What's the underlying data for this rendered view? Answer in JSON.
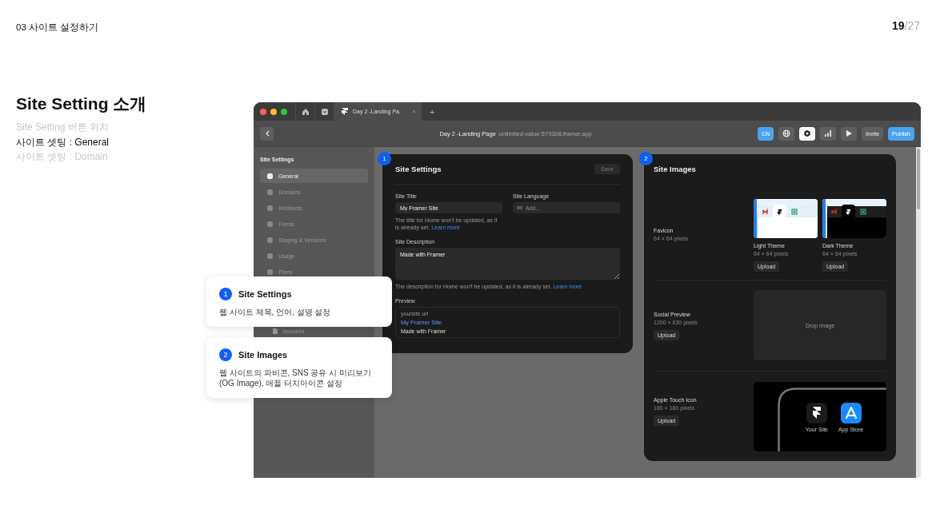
{
  "slide": {
    "section": "03  사이트 설정하기",
    "page": "19",
    "total": "/27",
    "title": "Site Setting 소개",
    "steps": [
      {
        "label": "Site Setting 버튼 위치",
        "selected": false
      },
      {
        "label": "사이트 셋팅 : General",
        "selected": true
      },
      {
        "label": "사이트 셋팅 : Domain",
        "selected": false
      }
    ]
  },
  "window": {
    "tabs": [
      {
        "kind": "home",
        "selected": false
      },
      {
        "kind": "inbox",
        "selected": false
      },
      {
        "kind": "doc",
        "label": "Day 2 -Landing Pa.",
        "close": "×",
        "selected": true
      }
    ],
    "new_tab": "+",
    "toolbar": {
      "title": "Day 2 -Landing Page",
      "url": "unlimited-value-579308.framer.app",
      "buttons": [
        {
          "kind": "text",
          "label": "CN",
          "primary": true,
          "selected": false
        },
        {
          "kind": "globe",
          "primary": false,
          "selected": false
        },
        {
          "kind": "gear",
          "primary": false,
          "selected": true
        },
        {
          "kind": "chart",
          "primary": false,
          "selected": false
        },
        {
          "kind": "play",
          "primary": false,
          "selected": false
        },
        {
          "kind": "text",
          "label": "Invite",
          "primary": false,
          "selected": false
        },
        {
          "kind": "text",
          "label": "Publish",
          "primary": true,
          "selected": false
        }
      ]
    },
    "sidebar": {
      "title": "Site Settings",
      "items": [
        {
          "label": "General",
          "selected": true
        },
        {
          "label": "Domains",
          "selected": false
        },
        {
          "label": "Redirects",
          "selected": false
        },
        {
          "label": "Forms",
          "selected": false
        },
        {
          "label": "Staging & Versions",
          "selected": false
        },
        {
          "label": "Usage",
          "selected": false
        },
        {
          "label": "Plans",
          "selected": false
        }
      ],
      "pages": [
        {
          "label": "/success"
        }
      ]
    },
    "settings_panel": {
      "badge": "1",
      "title": "Site Settings",
      "save": {
        "label": "Save",
        "disabled": true
      },
      "site_title": {
        "label": "Site Title",
        "value": "My Framer Site",
        "help": "The title for Home won't be updated, as it is already set.",
        "link": "Learn more"
      },
      "site_language": {
        "label": "Site Language",
        "placeholder": "Add..."
      },
      "description": {
        "label": "Site Description",
        "value": "Made with Framer",
        "help": "The description for Home won't be updated, as it is already set.",
        "link": "Learn more"
      },
      "preview": {
        "label": "Preview",
        "url": "yoursite.url",
        "title": "My Framer Site",
        "text": "Made with Framer"
      }
    },
    "images_panel": {
      "badge": "2",
      "title": "Site Images",
      "favicon": {
        "label": "Favicon",
        "size": "64 × 64 pixels",
        "themes": [
          {
            "kind": "light",
            "label": "Light Theme",
            "size": "64 × 64 pixels",
            "button": "Upload"
          },
          {
            "kind": "dark",
            "label": "Dark Theme",
            "size": "64 × 64 pixels",
            "button": "Upload"
          }
        ]
      },
      "social": {
        "label": "Social Preview",
        "size": "1200 × 630 pixels",
        "button": "Upload",
        "drop": "Drop image"
      },
      "touch": {
        "label": "Apple Touch Icon",
        "size": "180 × 180 pixels",
        "button": "Upload",
        "apps": [
          {
            "kind": "site",
            "label": "Your Site"
          },
          {
            "kind": "store",
            "label": "App Store"
          }
        ]
      }
    }
  },
  "callouts": [
    {
      "number": "1",
      "title": "Site Settings",
      "text": "웹 사이트 제목, 언어, 설명 설정"
    },
    {
      "number": "2",
      "title": "Site Images",
      "text": "웹 사이트의 파비콘, SNS 공유 시 미리보기 (OG Image), 애플 터치아이콘 설정"
    }
  ]
}
